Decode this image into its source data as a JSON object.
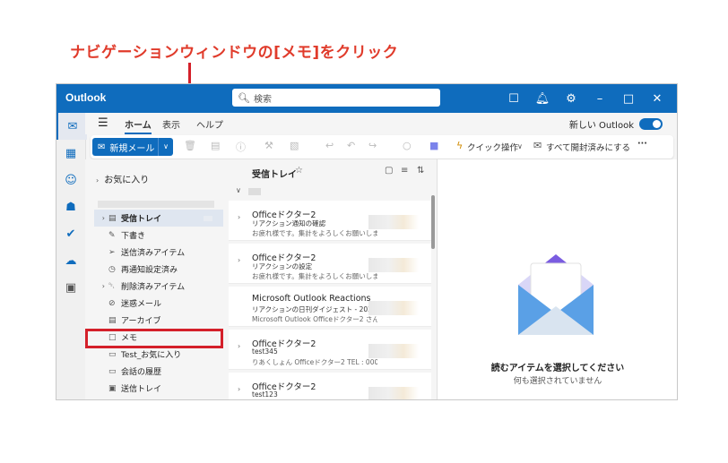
{
  "annotation": {
    "text": "ナビゲーションウィンドウの[メモ]をクリック",
    "color": "#d4202a"
  },
  "window": {
    "app_name": "Outlook",
    "search_placeholder": "検索",
    "accent": "#0f6cbd"
  },
  "tabs": {
    "items": [
      "ホーム",
      "表示",
      "ヘルプ"
    ],
    "new_outlook_label": "新しい Outlook",
    "new_outlook_on": true
  },
  "ribbon": {
    "new_mail_label": "新規メール",
    "quick_steps_label": "クイック操作",
    "mark_all_read_label": "すべて開封済みにする",
    "more_label": "···"
  },
  "nav": {
    "favorites_label": "お気に入り",
    "folders": [
      {
        "label": "受信トレイ",
        "icon": "inbox-icon",
        "chevron": "›",
        "selected": true
      },
      {
        "label": "下書き",
        "icon": "pencil-icon",
        "chevron": "",
        "selected": false
      },
      {
        "label": "送信済みアイテム",
        "icon": "send-icon",
        "chevron": "",
        "selected": false
      },
      {
        "label": "再通知設定済み",
        "icon": "clock-icon",
        "chevron": "",
        "selected": false
      },
      {
        "label": "削除済みアイテム",
        "icon": "trash-icon",
        "chevron": "›",
        "selected": false
      },
      {
        "label": "迷惑メール",
        "icon": "junk-icon",
        "chevron": "",
        "selected": false
      },
      {
        "label": "アーカイブ",
        "icon": "archive-icon",
        "chevron": "",
        "selected": false
      },
      {
        "label": "メモ",
        "icon": "note-icon",
        "chevron": "",
        "selected": false
      },
      {
        "label": "Test_お気に入り",
        "icon": "folder-icon",
        "chevron": "",
        "selected": false
      },
      {
        "label": "会話の履歴",
        "icon": "folder-icon",
        "chevron": "",
        "selected": false
      },
      {
        "label": "送信トレイ",
        "icon": "outbox-icon",
        "chevron": "",
        "selected": false
      }
    ]
  },
  "list": {
    "title": "受信トレイ",
    "messages": [
      {
        "sender": "Officeドクター2",
        "subject": "リアクション通知の確認",
        "preview": "お疲れ様です。集計をよろしくお願いしま",
        "date": ""
      },
      {
        "sender": "Officeドクター2",
        "subject": "リアクションの設定",
        "preview": "お疲れ様です。集計をよろしくお願いしま",
        "date": ""
      },
      {
        "sender": "Microsoft Outlook Reactions",
        "subject": "リアクションの日刊ダイジェスト - 2025...",
        "preview": "Microsoft Outlook Officeドクター2 さん",
        "date": ""
      },
      {
        "sender": "Officeドクター2",
        "subject": "test345",
        "preview": "りあくしょん Officeドクター2 TEL : 000-X",
        "date": ""
      },
      {
        "sender": "Officeドクター2",
        "subject": "test123",
        "preview": "",
        "date": "2025/03/13"
      }
    ]
  },
  "reading": {
    "title": "読むアイテムを選択してください",
    "subtitle": "何も選択されていません"
  }
}
